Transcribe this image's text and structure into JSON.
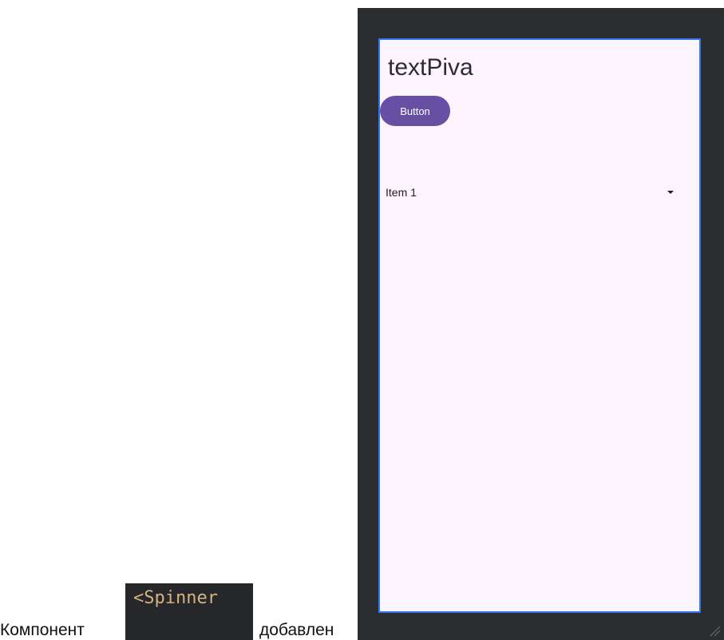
{
  "caption": {
    "prefix": "Компонент",
    "code_snippet": "<Spinner",
    "suffix": "добавлен"
  },
  "preview": {
    "text_view": "textPiva",
    "button_label": "Button",
    "spinner_selected": "Item 1",
    "spinner_icon": "dropdown-arrow-icon",
    "resize_icon": "resize-grip-icon"
  },
  "colors": {
    "ide_background": "#2b2d30",
    "screen_background": "#fcf5fd",
    "selection_border": "#3574f0",
    "button_accent": "#6750a4",
    "code_text": "#d6b280"
  }
}
